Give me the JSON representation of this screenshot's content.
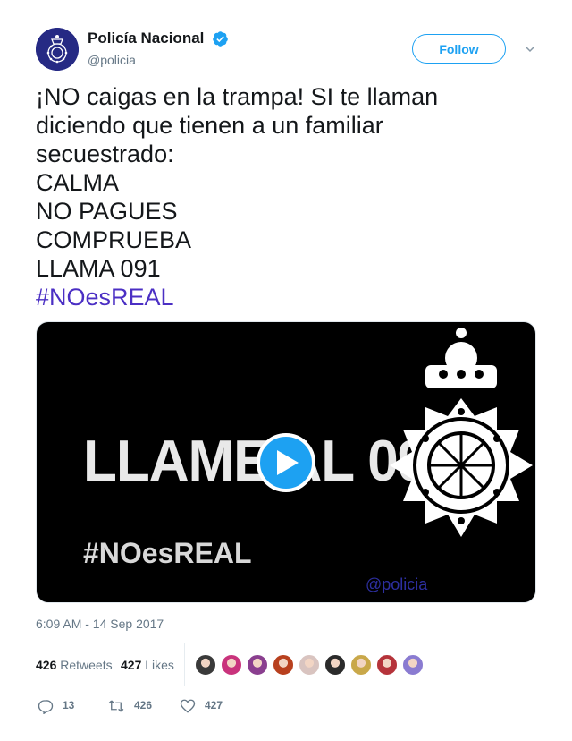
{
  "author": {
    "display_name": "Policía Nacional",
    "handle": "@policia",
    "verified": true,
    "follow_label": "Follow"
  },
  "tweet": {
    "lines": [
      "¡NO caigas en la trampa! SI te llaman",
      "diciendo que tienen a un familiar",
      "secuestrado:",
      "CALMA",
      "NO PAGUES",
      "COMPRUEBA",
      "LLAMA 091"
    ],
    "hashtag": "#NOesREAL",
    "timestamp": "6:09 AM - 14 Sep 2017"
  },
  "media": {
    "type": "video",
    "headline": "LLAME AL 091",
    "hashtag": "#NOesREAL",
    "watermark": "@policia"
  },
  "stats": {
    "retweets_count": "426",
    "retweets_label": "Retweets",
    "likes_count": "427",
    "likes_label": "Likes"
  },
  "likers": [
    "#3a3a3a",
    "#c9337c",
    "#8a3f8f",
    "#b8401e",
    "#d9c4c0",
    "#2b2b2b",
    "#c9a84a",
    "#b5333a",
    "#8a7bd1"
  ],
  "actions": {
    "replies": "13",
    "retweets": "426",
    "likes": "427"
  },
  "colors": {
    "accent": "#1da1f2",
    "hashtag": "#4b2fc4",
    "muted": "#657786"
  }
}
